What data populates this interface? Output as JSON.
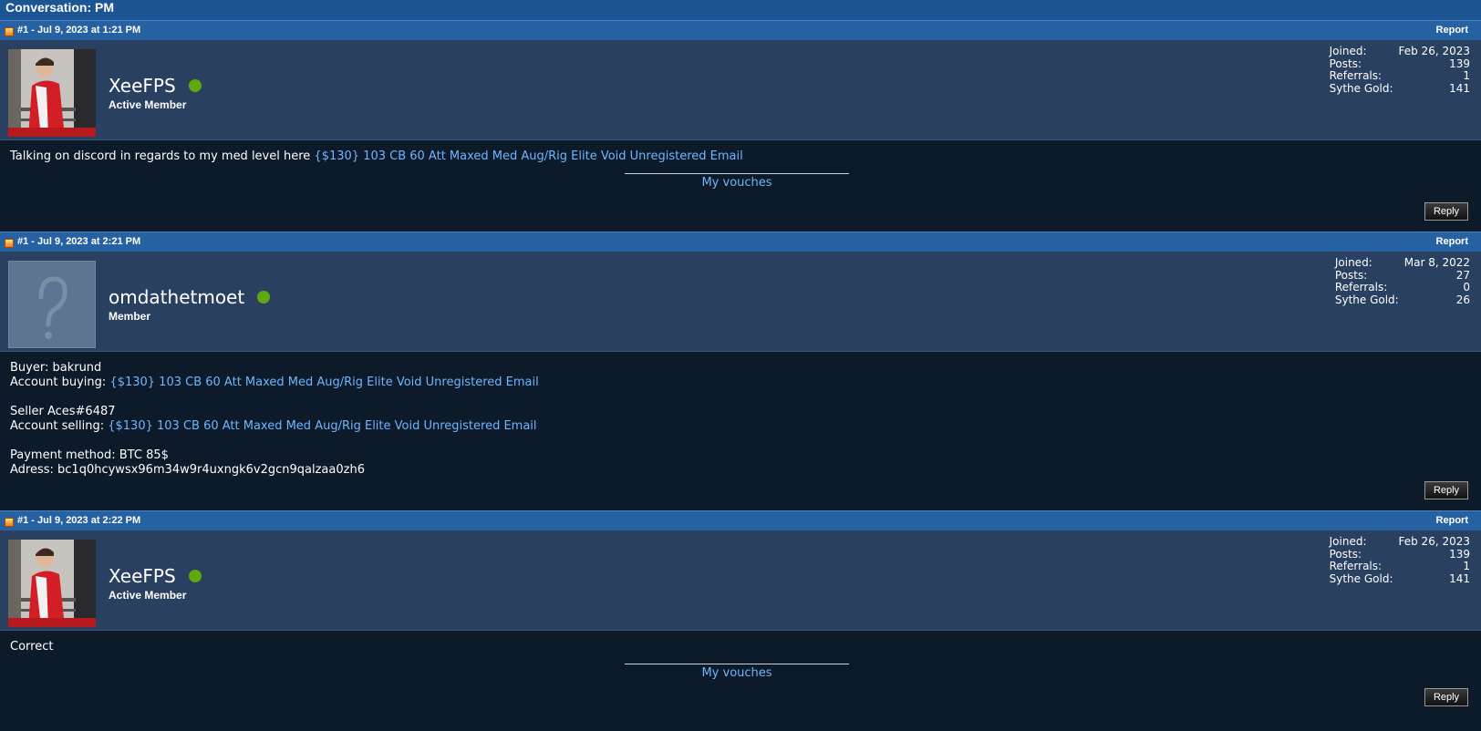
{
  "conversation_title": "Conversation: PM",
  "posts": [
    {
      "header": "#1 - Jul 9, 2023 at 1:21 PM",
      "report": "Report",
      "username": "XeeFPS",
      "rank": "Active Member",
      "stats": {
        "joined_label": "Joined:",
        "joined": "Feb 26, 2023",
        "posts_label": "Posts:",
        "posts": "139",
        "referrals_label": "Referrals:",
        "referrals": "1",
        "gold_label": "Sythe Gold:",
        "gold": "141"
      },
      "body_text": "Talking on discord in regards to my med level here ",
      "body_link": "{$130} 103 CB 60 Att Maxed Med Aug/Rig Elite Void Unregistered Email",
      "signature_link": "My vouches",
      "reply": "Reply"
    },
    {
      "header": "#1 - Jul 9, 2023 at 2:21 PM",
      "report": "Report",
      "username": "omdathetmoet",
      "rank": "Member",
      "stats": {
        "joined_label": "Joined:",
        "joined": "Mar 8, 2022",
        "posts_label": "Posts:",
        "posts": "27",
        "referrals_label": "Referrals:",
        "referrals": "0",
        "gold_label": "Sythe Gold:",
        "gold": "26"
      },
      "lines": {
        "buyer": "Buyer: bakrund",
        "account_buying_label": "Account buying: ",
        "account_buying_link": "{$130} 103 CB 60 Att Maxed Med Aug/Rig Elite Void Unregistered Email",
        "seller": "Seller Aces#6487",
        "account_selling_label": "Account selling: ",
        "account_selling_link": "{$130} 103 CB 60 Att Maxed Med Aug/Rig Elite Void Unregistered Email",
        "payment": "Payment method: BTC 85$",
        "address": "Adress: bc1q0hcywsx96m34w9r4uxngk6v2gcn9qalzaa0zh6"
      },
      "reply": "Reply"
    },
    {
      "header": "#1 - Jul 9, 2023 at 2:22 PM",
      "report": "Report",
      "username": "XeeFPS",
      "rank": "Active Member",
      "stats": {
        "joined_label": "Joined:",
        "joined": "Feb 26, 2023",
        "posts_label": "Posts:",
        "posts": "139",
        "referrals_label": "Referrals:",
        "referrals": "1",
        "gold_label": "Sythe Gold:",
        "gold": "141"
      },
      "body_text": "Correct",
      "signature_link": "My vouches",
      "reply": "Reply"
    }
  ]
}
